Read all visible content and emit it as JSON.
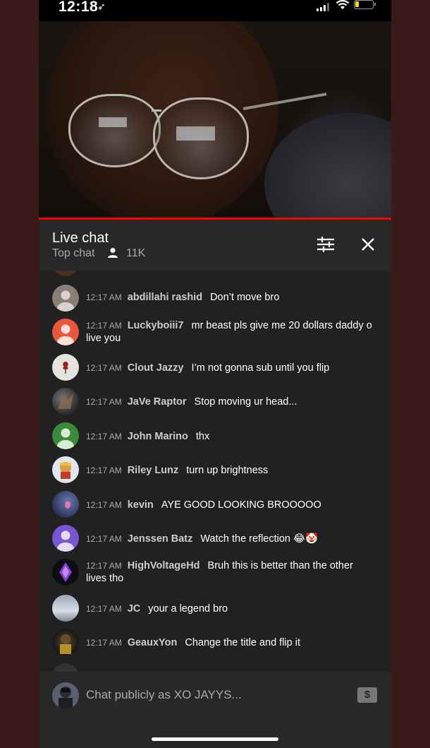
{
  "status_bar": {
    "time": "12:18",
    "location_glyph": "➶"
  },
  "chat": {
    "title": "Live chat",
    "mode": "Top chat",
    "viewer_count": "11K",
    "messages": [
      {
        "time": "12:17 AM",
        "author": "abdillahi rashid",
        "text": "Don’t move bro"
      },
      {
        "time": "12:17 AM",
        "author": "Luckyboiii7",
        "text": "mr beast pls give me 20 dollars daddy o",
        "text_cont": "live you"
      },
      {
        "time": "12:17 AM",
        "author": "Clout Jazzy",
        "text": "I’m not gonna sub until you flip"
      },
      {
        "time": "12:17 AM",
        "author": "JaVe Raptor",
        "text": "Stop moving ur head..."
      },
      {
        "time": "12:17 AM",
        "author": "John Marino",
        "text": "thx"
      },
      {
        "time": "12:17 AM",
        "author": "Riley Lunz",
        "text": "turn up brightness"
      },
      {
        "time": "12:17 AM",
        "author": "kevin",
        "text": "AYE GOOD LOOKING BROOOOO"
      },
      {
        "time": "12:17 AM",
        "author": "Jenssen Batz",
        "text": "Watch the reflection 😂🤡"
      },
      {
        "time": "12:17 AM",
        "author": "HighVoltageHd",
        "text": "Bruh this is better than the other",
        "text_cont": "lives tho"
      },
      {
        "time": "12:17 AM",
        "author": "JC",
        "text": "your a legend bro"
      },
      {
        "time": "12:17 AM",
        "author": "GeauxYon",
        "text": "Change the title and flip it"
      }
    ]
  },
  "input": {
    "placeholder": "Chat publicly as XO JAYYS...",
    "super_chat_glyph": "$"
  },
  "colors": {
    "chat_bg": "#212121",
    "header_bg": "#282828",
    "progress": "#ff0000",
    "avatar_gray": "#8a7f78",
    "avatar_orange": "#e8573a",
    "avatar_green": "#3a8a3a",
    "avatar_purple": "#7b54d1"
  }
}
